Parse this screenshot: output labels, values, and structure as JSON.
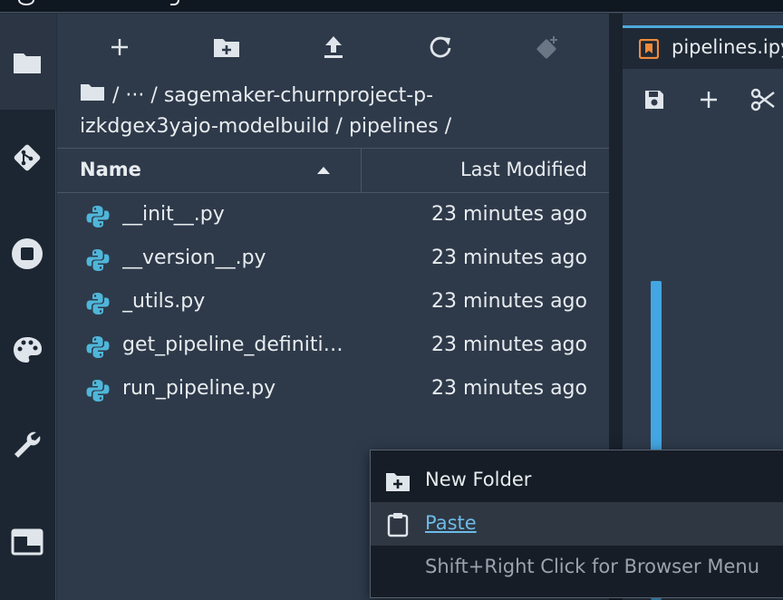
{
  "browser": {
    "toolbar": {
      "new_launcher_icon": "plus-icon",
      "new_folder_icon": "new-folder-icon",
      "upload_icon": "upload-icon",
      "refresh_icon": "refresh-icon",
      "git_clone_icon": "git-clone-icon"
    },
    "breadcrumb": {
      "sep1": "/",
      "ellipsis": "···",
      "sep2": "/",
      "folder": "sagemaker-churnproject-p-izkdgex3yajo-modelbuild",
      "sep3": "/",
      "subfolder": "pipelines",
      "sep4": "/"
    },
    "columns": {
      "name": "Name",
      "modified": "Last Modified"
    },
    "files": [
      {
        "name": "__init__.py",
        "modified": "23 minutes ago"
      },
      {
        "name": "__version__.py",
        "modified": "23 minutes ago"
      },
      {
        "name": "_utils.py",
        "modified": "23 minutes ago"
      },
      {
        "name": "get_pipeline_definition.py",
        "modified": "23 minutes ago"
      },
      {
        "name": "run_pipeline.py",
        "modified": "23 minutes ago"
      }
    ]
  },
  "notebook": {
    "tab_title": "pipelines.ipynb"
  },
  "context_menu": {
    "items": [
      {
        "label": "New Folder"
      },
      {
        "label": "Paste"
      },
      {
        "label": "Shift+Right Click for Browser Menu"
      }
    ]
  },
  "colors": {
    "accent": "#4fa9de",
    "python_icon": "#4fb6d9",
    "panel_bg": "#2e3a4a"
  }
}
